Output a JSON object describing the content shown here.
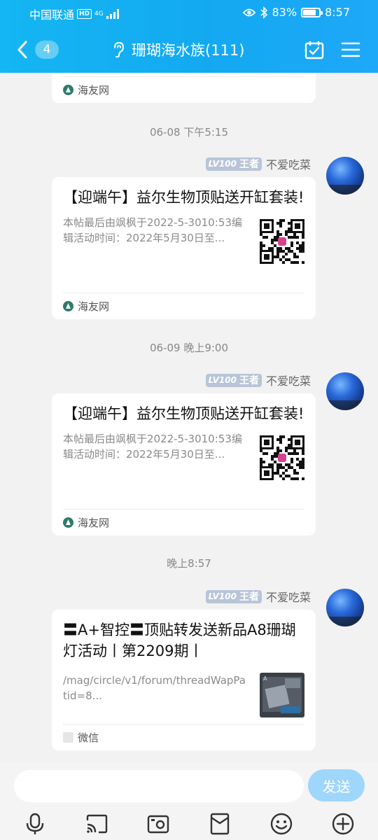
{
  "status_bar": {
    "carrier": "中国联通",
    "network_badge": "HD",
    "signal": "4G",
    "battery_percent": "83%",
    "battery_level": 0.83,
    "time": "8:57"
  },
  "header": {
    "back_count": "4",
    "group_name": "珊瑚海水族(111)",
    "icons": [
      "chevron-left-icon",
      "ear-icon",
      "calendar-check-icon",
      "menu-icon"
    ]
  },
  "messages": {
    "top_partial": {
      "source": "海友网"
    },
    "timestamps": [
      "06-08 下午5:15",
      "06-09 晚上9:00",
      "晚上8:57"
    ],
    "items": [
      {
        "level": "LV100",
        "rank": "王者",
        "sender": "不爱吃菜",
        "title": "【迎端午】益尔生物顶贴送开缸套装!",
        "desc": "本帖最后由飒枫于2022-5-3010:53编辑活动时间：2022年5月30日至...",
        "thumb": "qr-code",
        "source": "海友网"
      },
      {
        "level": "LV100",
        "rank": "王者",
        "sender": "不爱吃菜",
        "title": "【迎端午】益尔生物顶贴送开缸套装!",
        "desc": "本帖最后由飒枫于2022-5-3010:53编辑活动时间：2022年5月30日至...",
        "thumb": "qr-code",
        "source": "海友网"
      },
      {
        "level": "LV100",
        "rank": "王者",
        "sender": "不爱吃菜",
        "title": "〓A+智控〓顶贴转发送新品A8珊瑚灯活动丨第2209期丨",
        "desc": "/mag/circle/v1/forum/threadWapPage?tid=8...",
        "thumb": "product-image",
        "source": "微信"
      }
    ]
  },
  "input": {
    "placeholder": "",
    "send_label": "发送"
  },
  "toolbar": {
    "icons": [
      "microphone-icon",
      "cast-screen-icon",
      "photo-icon",
      "red-packet-icon",
      "emoji-icon",
      "plus-circle-icon"
    ]
  },
  "colors": {
    "header": "#14b0f3",
    "send_button": "#9fd6fb",
    "background": "#f2f2f2"
  }
}
